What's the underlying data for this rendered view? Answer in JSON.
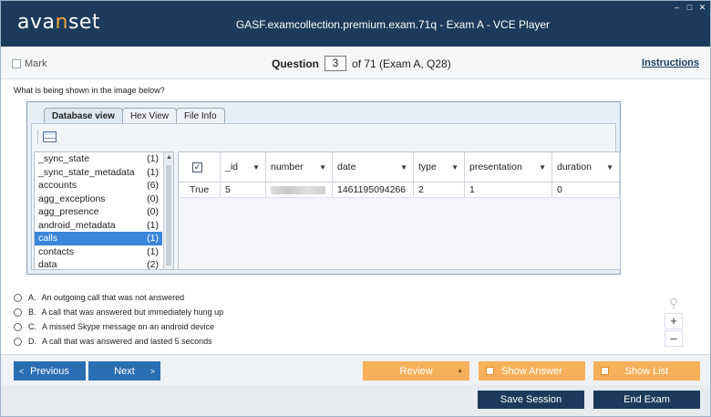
{
  "window": {
    "logo_text_pre": "ava",
    "logo_text_accent": "n",
    "logo_text_post": "set",
    "title": "GASF.examcollection.premium.exam.71q - Exam A - VCE Player",
    "controls": [
      "–",
      "□",
      "✕"
    ]
  },
  "header": {
    "mark_label": "Mark",
    "question_label": "Question",
    "question_number": "3",
    "of_text": "of 71 (Exam A, Q28)",
    "instructions_label": "Instructions"
  },
  "question": {
    "prompt": "What is being shown in the image below?"
  },
  "db_image": {
    "tabs": [
      "Database view",
      "Hex View",
      "File Info"
    ],
    "tables": [
      {
        "name": "_sync_state",
        "count": "(1)"
      },
      {
        "name": "_sync_state_metadata",
        "count": "(1)"
      },
      {
        "name": "accounts",
        "count": "(6)"
      },
      {
        "name": "agg_exceptions",
        "count": "(0)"
      },
      {
        "name": "agg_presence",
        "count": "(0)"
      },
      {
        "name": "android_metadata",
        "count": "(1)"
      },
      {
        "name": "calls",
        "count": "(1)"
      },
      {
        "name": "contacts",
        "count": "(1)"
      },
      {
        "name": "data",
        "count": "(2)"
      }
    ],
    "selected_table": "calls",
    "columns": [
      "_id",
      "number",
      "date",
      "type",
      "presentation",
      "duration"
    ],
    "row": {
      "checked": "True",
      "_id": "5",
      "number": "",
      "date": "1461195094266",
      "type": "2",
      "presentation": "1",
      "duration": "0"
    }
  },
  "answers": [
    {
      "letter": "A.",
      "text": "An outgoing call that was not answered"
    },
    {
      "letter": "B.",
      "text": "A call that was answered but immediately hung up"
    },
    {
      "letter": "C.",
      "text": "A missed Skype message on an android device"
    },
    {
      "letter": "D.",
      "text": "A call that was answered and lasted 5 seconds"
    }
  ],
  "zoom": {
    "in": "+",
    "out": "–"
  },
  "nav": {
    "previous": "Previous",
    "next": "Next",
    "review": "Review",
    "show_answer": "Show Answer",
    "show_list": "Show List",
    "save_session": "Save Session",
    "end_exam": "End Exam"
  },
  "colors": {
    "titlebar": "#1c3a5c",
    "accent_orange": "#f7b15a",
    "nav_blue": "#2a6fb3",
    "selected_row": "#3a86d8"
  }
}
